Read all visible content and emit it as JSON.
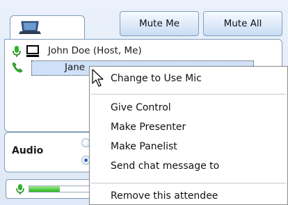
{
  "toolbar": {
    "mute_me_label": "Mute Me",
    "mute_all_label": "Mute All"
  },
  "participants": [
    {
      "name": "John Doe (Host, Me)",
      "audio": "mic-icon",
      "device": "computer-icon"
    },
    {
      "name": "Jane",
      "audio": "phone-icon"
    }
  ],
  "audio": {
    "label": "Audio",
    "selected_option": 2
  },
  "mic_level": 0.45,
  "context_menu": {
    "items": [
      "Change to Use Mic",
      "Give Control",
      "Make Presenter",
      "Make Panelist",
      "Send chat message to",
      "Remove this attendee"
    ]
  },
  "colors": {
    "accent_blue": "#7f9db9",
    "selection": "#cfe0f7",
    "mic_green": "#27b21d"
  }
}
